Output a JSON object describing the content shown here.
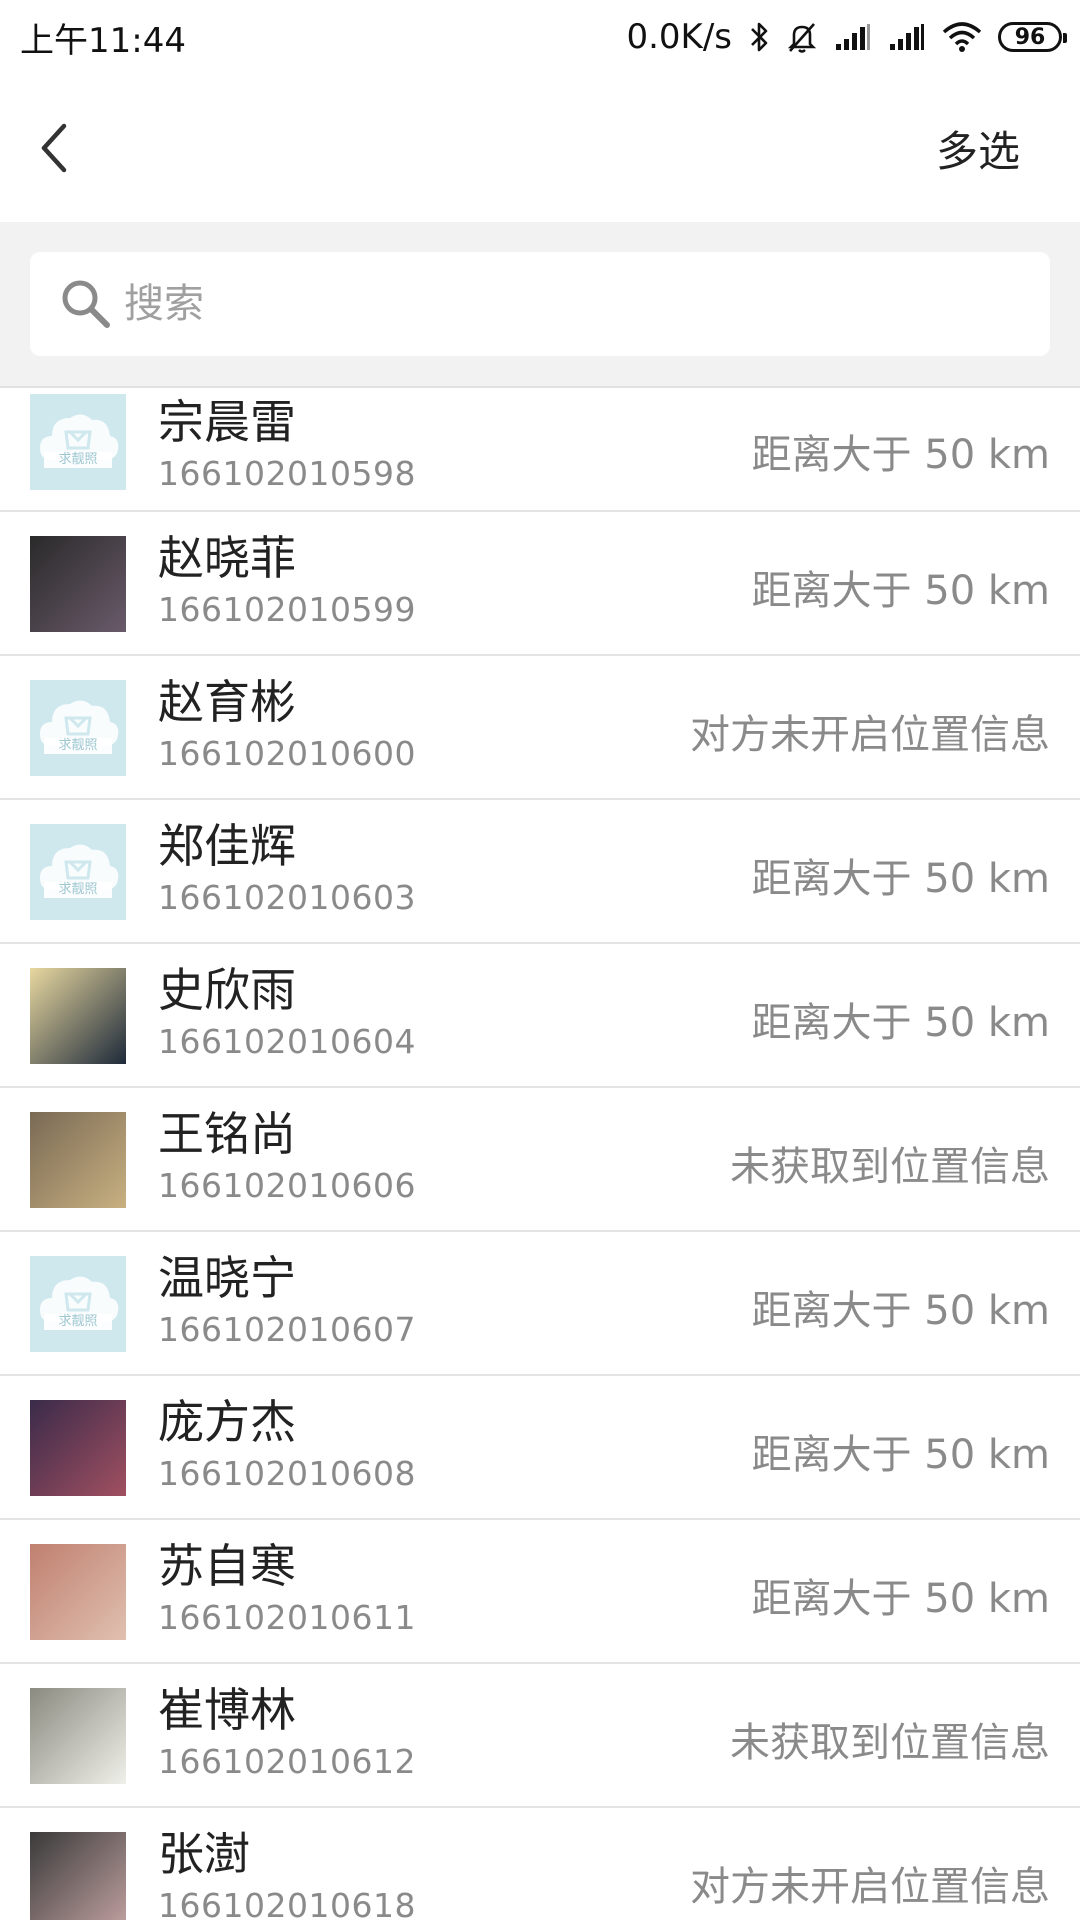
{
  "status_bar": {
    "time": "上午11:44",
    "net_speed": "0.0K/s",
    "battery": "96",
    "icons": [
      "bluetooth-icon",
      "mute-bell-icon",
      "signal-icon",
      "signal-icon",
      "wifi-icon",
      "battery-icon"
    ]
  },
  "header": {
    "back_icon": "chevron-left-icon",
    "multi_select_label": "多选"
  },
  "search": {
    "icon": "search-icon",
    "placeholder": "搜索"
  },
  "contacts": [
    {
      "name": "宗晨雷",
      "id": "166102010598",
      "status": "距离大于 50 km",
      "avatar": "placeholder"
    },
    {
      "name": "赵晓菲",
      "id": "166102010599",
      "status": "距离大于 50 km",
      "avatar": "photo"
    },
    {
      "name": "赵育彬",
      "id": "166102010600",
      "status": "对方未开启位置信息",
      "avatar": "placeholder"
    },
    {
      "name": "郑佳辉",
      "id": "166102010603",
      "status": "距离大于 50 km",
      "avatar": "placeholder"
    },
    {
      "name": "史欣雨",
      "id": "166102010604",
      "status": "距离大于 50 km",
      "avatar": "photo"
    },
    {
      "name": "王铭尚",
      "id": "166102010606",
      "status": "未获取到位置信息",
      "avatar": "photo"
    },
    {
      "name": "温晓宁",
      "id": "166102010607",
      "status": "距离大于 50 km",
      "avatar": "placeholder"
    },
    {
      "name": "庞方杰",
      "id": "166102010608",
      "status": "距离大于 50 km",
      "avatar": "photo"
    },
    {
      "name": "苏自寒",
      "id": "166102010611",
      "status": "距离大于 50 km",
      "avatar": "photo"
    },
    {
      "name": "崔博林",
      "id": "166102010612",
      "status": "未获取到位置信息",
      "avatar": "photo"
    },
    {
      "name": "张澍",
      "id": "166102010618",
      "status": "对方未开启位置信息",
      "avatar": "photo"
    }
  ],
  "placeholder_avatar_text": "求靓照",
  "colors": {
    "placeholder_bg": "#cfe8ee",
    "status_text": "#8a8a8a",
    "divider": "#e4e4e4",
    "search_bg": "#f2f2f2"
  }
}
